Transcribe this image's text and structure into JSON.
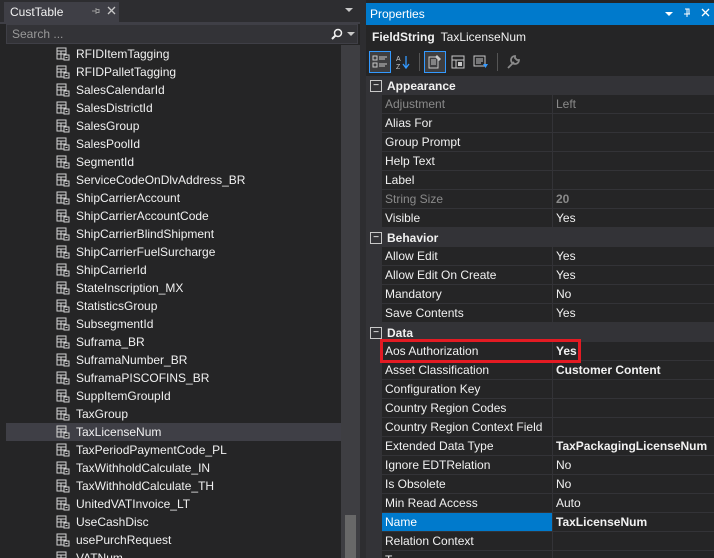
{
  "left_pane": {
    "tab_title": "CustTable",
    "pin_icon": "pin-icon",
    "close_icon": "close-icon",
    "search_placeholder": "Search ...",
    "tree_items": [
      {
        "label": "RFIDItemTagging",
        "selected": false
      },
      {
        "label": "RFIDPalletTagging",
        "selected": false
      },
      {
        "label": "SalesCalendarId",
        "selected": false
      },
      {
        "label": "SalesDistrictId",
        "selected": false
      },
      {
        "label": "SalesGroup",
        "selected": false
      },
      {
        "label": "SalesPoolId",
        "selected": false
      },
      {
        "label": "SegmentId",
        "selected": false
      },
      {
        "label": "ServiceCodeOnDlvAddress_BR",
        "selected": false
      },
      {
        "label": "ShipCarrierAccount",
        "selected": false
      },
      {
        "label": "ShipCarrierAccountCode",
        "selected": false
      },
      {
        "label": "ShipCarrierBlindShipment",
        "selected": false
      },
      {
        "label": "ShipCarrierFuelSurcharge",
        "selected": false
      },
      {
        "label": "ShipCarrierId",
        "selected": false
      },
      {
        "label": "StateInscription_MX",
        "selected": false
      },
      {
        "label": "StatisticsGroup",
        "selected": false
      },
      {
        "label": "SubsegmentId",
        "selected": false
      },
      {
        "label": "Suframa_BR",
        "selected": false
      },
      {
        "label": "SuframaNumber_BR",
        "selected": false
      },
      {
        "label": "SuframaPISCOFINS_BR",
        "selected": false
      },
      {
        "label": "SuppItemGroupId",
        "selected": false
      },
      {
        "label": "TaxGroup",
        "selected": false
      },
      {
        "label": "TaxLicenseNum",
        "selected": true
      },
      {
        "label": "TaxPeriodPaymentCode_PL",
        "selected": false
      },
      {
        "label": "TaxWithholdCalculate_IN",
        "selected": false
      },
      {
        "label": "TaxWithholdCalculate_TH",
        "selected": false
      },
      {
        "label": "UnitedVATInvoice_LT",
        "selected": false
      },
      {
        "label": "UseCashDisc",
        "selected": false
      },
      {
        "label": "usePurchRequest",
        "selected": false
      },
      {
        "label": "VATNum",
        "selected": false
      }
    ]
  },
  "properties": {
    "window_title": "Properties",
    "object_kind": "FieldString",
    "object_name": "TaxLicenseNum",
    "toolbar_icons": [
      "categorized-icon",
      "alphabetical-icon",
      "properties-icon",
      "events-icon",
      "property-pages-icon",
      "wrench-icon"
    ],
    "categories": [
      {
        "name": "Appearance",
        "expander": "−",
        "props": [
          {
            "name": "Adjustment",
            "value": "Left",
            "disabled": true,
            "bold": false,
            "selected": false
          },
          {
            "name": "Alias For",
            "value": "",
            "disabled": false,
            "bold": false,
            "selected": false
          },
          {
            "name": "Group Prompt",
            "value": "",
            "disabled": false,
            "bold": false,
            "selected": false
          },
          {
            "name": "Help Text",
            "value": "",
            "disabled": false,
            "bold": false,
            "selected": false
          },
          {
            "name": "Label",
            "value": "",
            "disabled": false,
            "bold": false,
            "selected": false
          },
          {
            "name": "String Size",
            "value": "20",
            "disabled": true,
            "bold": true,
            "selected": false
          },
          {
            "name": "Visible",
            "value": "Yes",
            "disabled": false,
            "bold": false,
            "selected": false
          }
        ]
      },
      {
        "name": "Behavior",
        "expander": "−",
        "props": [
          {
            "name": "Allow Edit",
            "value": "Yes",
            "disabled": false,
            "bold": false,
            "selected": false
          },
          {
            "name": "Allow Edit On Create",
            "value": "Yes",
            "disabled": false,
            "bold": false,
            "selected": false
          },
          {
            "name": "Mandatory",
            "value": "No",
            "disabled": false,
            "bold": false,
            "selected": false
          },
          {
            "name": "Save Contents",
            "value": "Yes",
            "disabled": false,
            "bold": false,
            "selected": false
          }
        ]
      },
      {
        "name": "Data",
        "expander": "−",
        "props": [
          {
            "name": "Aos Authorization",
            "value": "Yes",
            "disabled": false,
            "bold": true,
            "selected": false
          },
          {
            "name": "Asset Classification",
            "value": "Customer Content",
            "disabled": false,
            "bold": true,
            "selected": false
          },
          {
            "name": "Configuration Key",
            "value": "",
            "disabled": false,
            "bold": false,
            "selected": false
          },
          {
            "name": "Country Region Codes",
            "value": "",
            "disabled": false,
            "bold": false,
            "selected": false
          },
          {
            "name": "Country Region Context Field",
            "value": "",
            "disabled": false,
            "bold": false,
            "selected": false
          },
          {
            "name": "Extended Data Type",
            "value": "TaxPackagingLicenseNum",
            "disabled": false,
            "bold": true,
            "selected": false
          },
          {
            "name": "Ignore EDTRelation",
            "value": "No",
            "disabled": false,
            "bold": false,
            "selected": false
          },
          {
            "name": "Is Obsolete",
            "value": "No",
            "disabled": false,
            "bold": false,
            "selected": false
          },
          {
            "name": "Min Read Access",
            "value": "Auto",
            "disabled": false,
            "bold": false,
            "selected": false
          },
          {
            "name": "Name",
            "value": "TaxLicenseNum",
            "disabled": false,
            "bold": true,
            "selected": true
          },
          {
            "name": "Relation Context",
            "value": "",
            "disabled": false,
            "bold": false,
            "selected": false
          },
          {
            "name": "T",
            "value": "",
            "disabled": false,
            "bold": false,
            "selected": false
          }
        ]
      }
    ]
  },
  "colors": {
    "accent": "#007acc",
    "highlight_box": "#e31b23",
    "background": "#252526"
  }
}
